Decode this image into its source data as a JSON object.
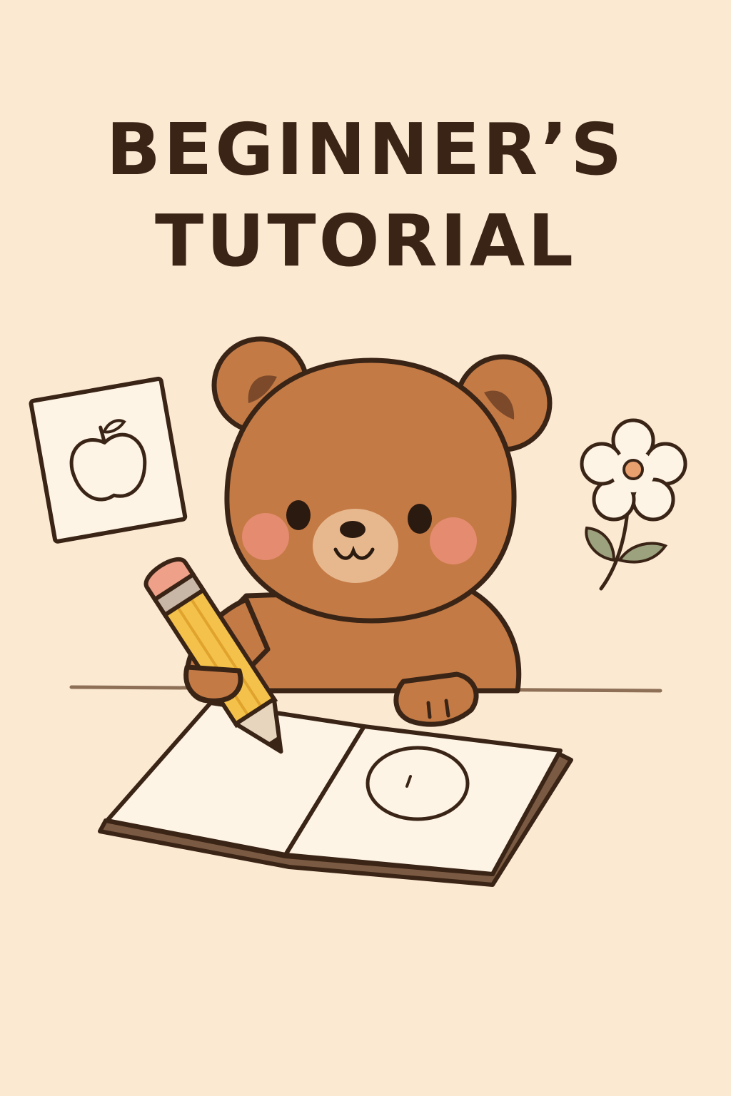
{
  "cover": {
    "title_line_1": "BEGINNER’S",
    "title_line_2": "TUTORIAL"
  },
  "colors": {
    "background": "#FCE9D2",
    "outline": "#3A2416",
    "bear_fur": "#C47A45",
    "bear_ear_inner": "#7C4A2A",
    "muzzle": "#E7B88E",
    "cheek": "#E98D73",
    "pencil_body": "#F4C24A",
    "pencil_eraser": "#EFA089",
    "paper": "#FDF4E6",
    "leaf": "#9CA17E",
    "flower_center": "#E9A06F"
  },
  "icons": {
    "apple_card": "apple-card-icon",
    "flower": "flower-icon",
    "pencil": "pencil-icon",
    "sketchbook": "sketchbook-icon",
    "bear": "bear-mascot"
  }
}
